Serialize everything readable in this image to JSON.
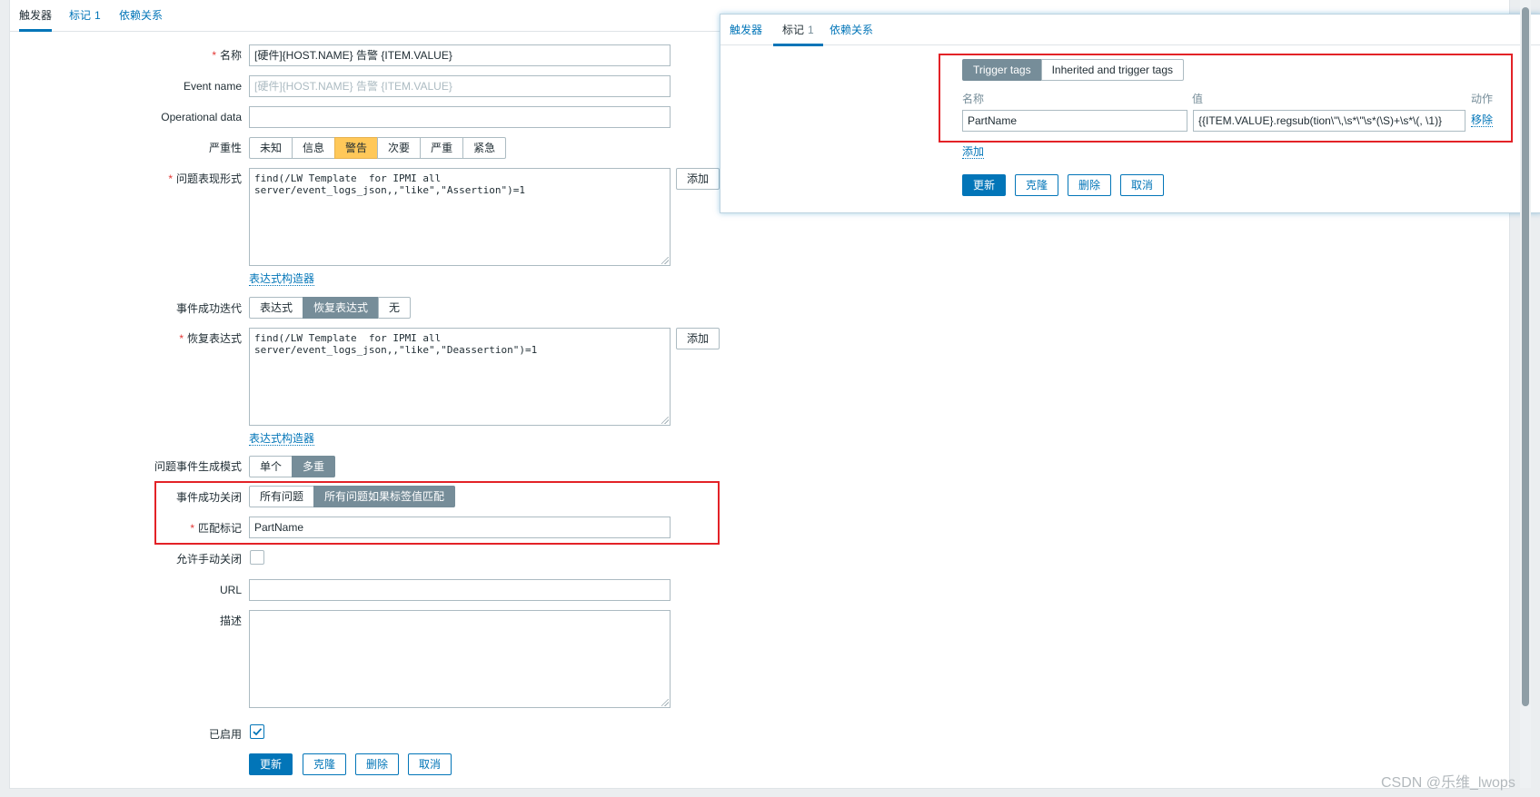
{
  "main": {
    "tabs": [
      {
        "label": "触发器",
        "count": ""
      },
      {
        "label": "标记",
        "count": "1"
      },
      {
        "label": "依赖关系",
        "count": ""
      }
    ],
    "form": {
      "name_label": "名称",
      "name_value": "[硬件]{HOST.NAME} 告警 {ITEM.VALUE}",
      "event_name_label": "Event name",
      "event_name_placeholder": "[硬件]{HOST.NAME} 告警 {ITEM.VALUE}",
      "operational_data_label": "Operational data",
      "operational_data_value": "",
      "severity_label": "严重性",
      "severity_options": [
        "未知",
        "信息",
        "警告",
        "次要",
        "严重",
        "紧急"
      ],
      "severity_selected": "警告",
      "expression_label": "问题表现形式",
      "expression_value": "find(/LW Template  for IPMI all\nserver/event_logs_json,,\"like\",\"Assertion\")=1",
      "add_label": "添加",
      "expression_builder_label": "表达式构造器",
      "ok_event_gen_label": "事件成功迭代",
      "ok_event_gen_options": [
        "表达式",
        "恢复表达式",
        "无"
      ],
      "ok_event_gen_selected": "恢复表达式",
      "recovery_label": "恢复表达式",
      "recovery_value": "find(/LW Template  for IPMI all\nserver/event_logs_json,,\"like\",\"Deassertion\")=1",
      "recovery_add_label": "添加",
      "recovery_builder_label": "表达式构造器",
      "problem_mode_label": "问题事件生成模式",
      "problem_mode_options": [
        "单个",
        "多重"
      ],
      "problem_mode_selected": "多重",
      "ok_close_label": "事件成功关闭",
      "ok_close_options": [
        "所有问题",
        "所有问题如果标签值匹配"
      ],
      "ok_close_selected": "所有问题如果标签值匹配",
      "match_tag_label": "匹配标记",
      "match_tag_value": "PartName",
      "manual_close_label": "允许手动关闭",
      "manual_close_checked": false,
      "url_label": "URL",
      "url_value": "",
      "description_label": "描述",
      "description_value": "",
      "enabled_label": "已启用",
      "enabled_checked": true
    },
    "buttons": {
      "update": "更新",
      "clone": "克隆",
      "delete": "删除",
      "cancel": "取消"
    }
  },
  "overlay": {
    "tabs": [
      {
        "label": "触发器",
        "count": ""
      },
      {
        "label": "标记",
        "count": "1"
      },
      {
        "label": "依赖关系",
        "count": ""
      }
    ],
    "tag_mode_options": [
      "Trigger tags",
      "Inherited and trigger tags"
    ],
    "tag_mode_selected": "Trigger tags",
    "col_name": "名称",
    "col_value": "值",
    "col_action": "动作",
    "tag_rows": [
      {
        "name": "PartName",
        "value": "{{ITEM.VALUE}.regsub(tion\\\"\\,\\s*\\\"\\s*(\\S)+\\s*\\(, \\1)}",
        "action": "移除"
      }
    ],
    "add_link": "添加",
    "buttons": {
      "update": "更新",
      "clone": "克隆",
      "delete": "删除",
      "cancel": "取消"
    }
  },
  "watermark": "CSDN @乐维_lwops",
  "colors": {
    "accent": "#0275b8",
    "selected_gray": "#768d99",
    "warning": "#ffc859",
    "highlight_box": "#e32227"
  }
}
